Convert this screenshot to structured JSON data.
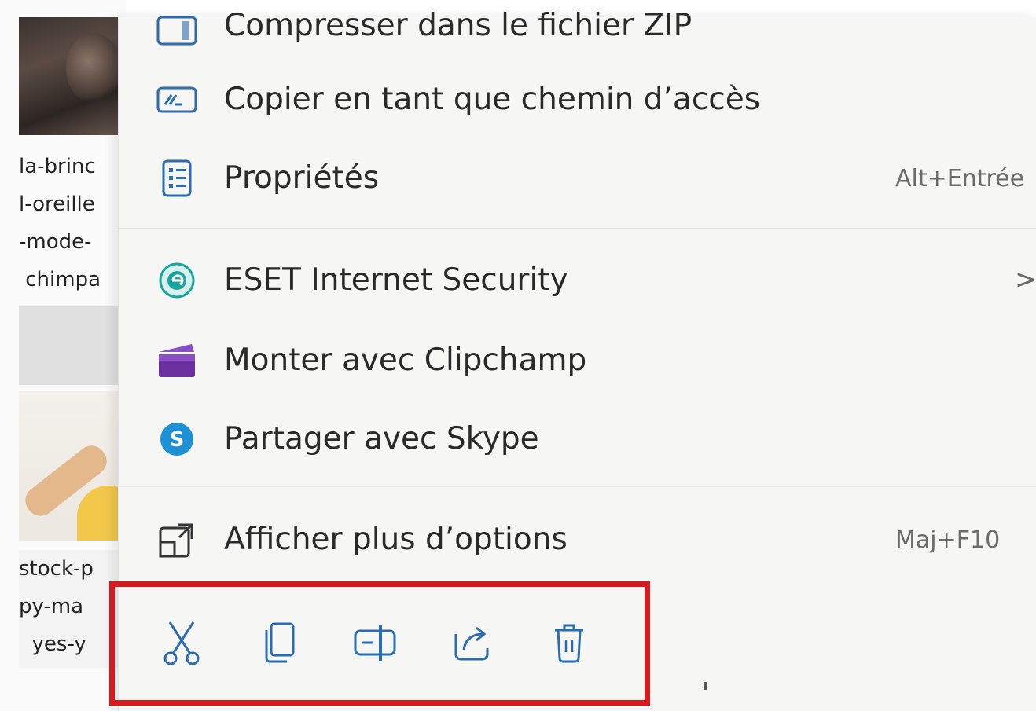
{
  "background": {
    "file_caption_1": "la-brinc\nl-oreille\n-mode-\n chimpa",
    "file_caption_2": "stock-p\npy-ma\n  yes-y"
  },
  "menu": {
    "items": [
      {
        "label": "Compresser dans le fichier ZIP",
        "icon": "zip-icon"
      },
      {
        "label": "Copier en tant que chemin d’accès",
        "icon": "path-copy-icon"
      },
      {
        "label": "Propriétés",
        "icon": "properties-icon",
        "shortcut": "Alt+Entrée"
      },
      {
        "label": "ESET Internet Security",
        "icon": "eset-icon",
        "has_submenu": true,
        "chevron": ">"
      },
      {
        "label": "Monter avec Clipchamp",
        "icon": "clipchamp-icon"
      },
      {
        "label": "Partager avec Skype",
        "icon": "skype-icon"
      },
      {
        "label": "Afficher plus d’options",
        "icon": "more-options-icon",
        "shortcut": "Maj+F10"
      }
    ],
    "quick_actions": [
      {
        "name": "cut",
        "icon": "scissors-icon"
      },
      {
        "name": "copy",
        "icon": "copy-icon"
      },
      {
        "name": "rename",
        "icon": "rename-icon"
      },
      {
        "name": "share",
        "icon": "share-icon"
      },
      {
        "name": "delete",
        "icon": "trash-icon"
      }
    ]
  },
  "colors": {
    "highlight_border": "#d71920",
    "icon_blue": "#2b6cb0",
    "clipchamp_purple": "#6b2fa0",
    "skype_blue": "#1e90d6",
    "eset_teal": "#1aa6a0"
  }
}
